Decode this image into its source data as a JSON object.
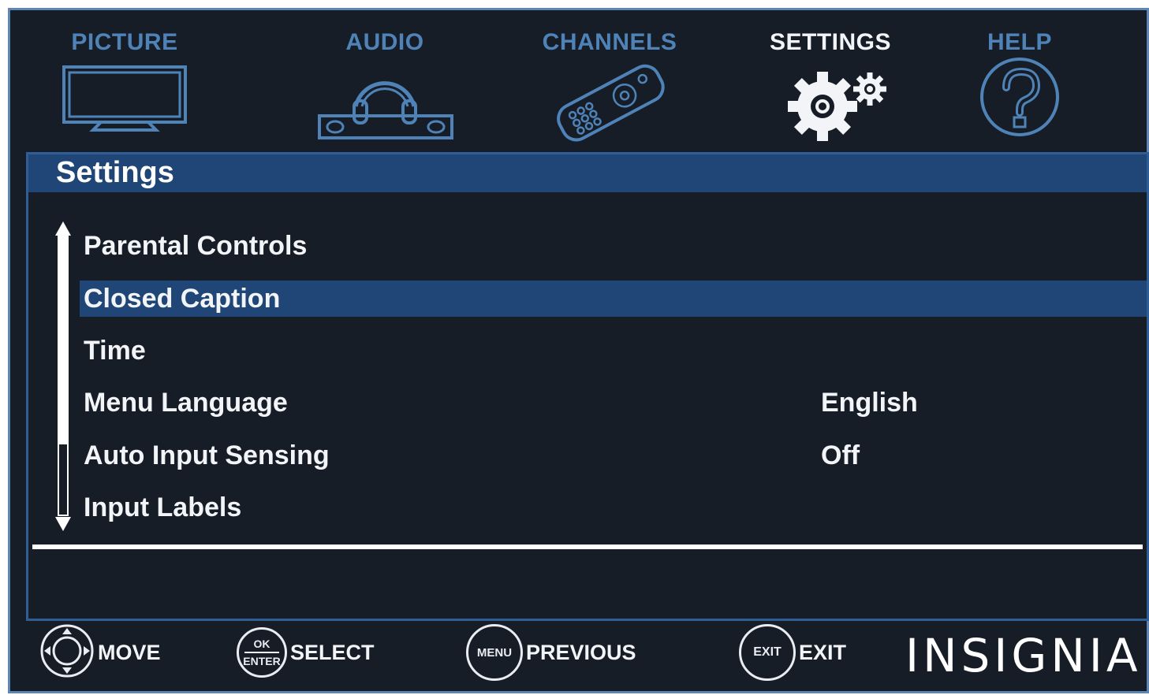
{
  "nav": {
    "tabs": [
      {
        "label": "PICTURE",
        "icon": "tv-icon",
        "active": false
      },
      {
        "label": "AUDIO",
        "icon": "headphones-icon",
        "active": false
      },
      {
        "label": "CHANNELS",
        "icon": "remote-icon",
        "active": false
      },
      {
        "label": "SETTINGS",
        "icon": "gears-icon",
        "active": true
      },
      {
        "label": "HELP",
        "icon": "help-icon",
        "active": false
      }
    ]
  },
  "panel": {
    "title": "Settings",
    "items": [
      {
        "label": "Parental Controls",
        "value": "",
        "selected": false
      },
      {
        "label": "Closed Caption",
        "value": "",
        "selected": true
      },
      {
        "label": "Time",
        "value": "",
        "selected": false
      },
      {
        "label": "Menu Language",
        "value": "English",
        "selected": false
      },
      {
        "label": "Auto Input Sensing",
        "value": "Off",
        "selected": false
      },
      {
        "label": "Input Labels",
        "value": "",
        "selected": false
      }
    ]
  },
  "footer": {
    "move": {
      "label": "MOVE",
      "icon": "dpad-icon"
    },
    "select": {
      "label": "SELECT",
      "icon_top": "OK",
      "icon_bottom": "ENTER"
    },
    "previous": {
      "label": "PREVIOUS",
      "icon_text": "MENU"
    },
    "exit": {
      "label": "EXIT",
      "icon_text": "EXIT"
    },
    "brand": "INSIGNIA"
  },
  "colors": {
    "background": "#161d27",
    "accent_blue": "#4f83b8",
    "selection": "#1f4677",
    "text": "#f2f4f7"
  }
}
